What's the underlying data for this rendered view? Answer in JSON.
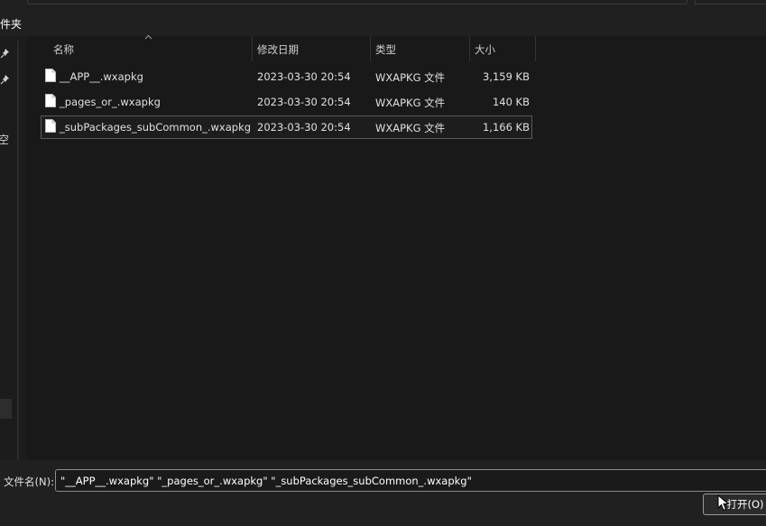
{
  "toolbar": {
    "folder_label": "件夹"
  },
  "nav": {
    "partial_label": "空"
  },
  "list": {
    "columns": {
      "name": "名称",
      "modified": "修改日期",
      "type": "类型",
      "size": "大小"
    },
    "files": [
      {
        "name": "__APP__.wxapkg",
        "modified": "2023-03-30 20:54",
        "type": "WXAPKG 文件",
        "size": "3,159 KB"
      },
      {
        "name": "_pages_or_.wxapkg",
        "modified": "2023-03-30 20:54",
        "type": "WXAPKG 文件",
        "size": "140 KB"
      },
      {
        "name": "_subPackages_subCommon_.wxapkg",
        "modified": "2023-03-30 20:54",
        "type": "WXAPKG 文件",
        "size": "1,166 KB"
      }
    ]
  },
  "footer": {
    "filename_label": "文件名(N):",
    "filename_value": "\"__APP__.wxapkg\" \"_pages_or_.wxapkg\" \"_subPackages_subCommon_.wxapkg\"",
    "open_label": "打开(O)"
  }
}
